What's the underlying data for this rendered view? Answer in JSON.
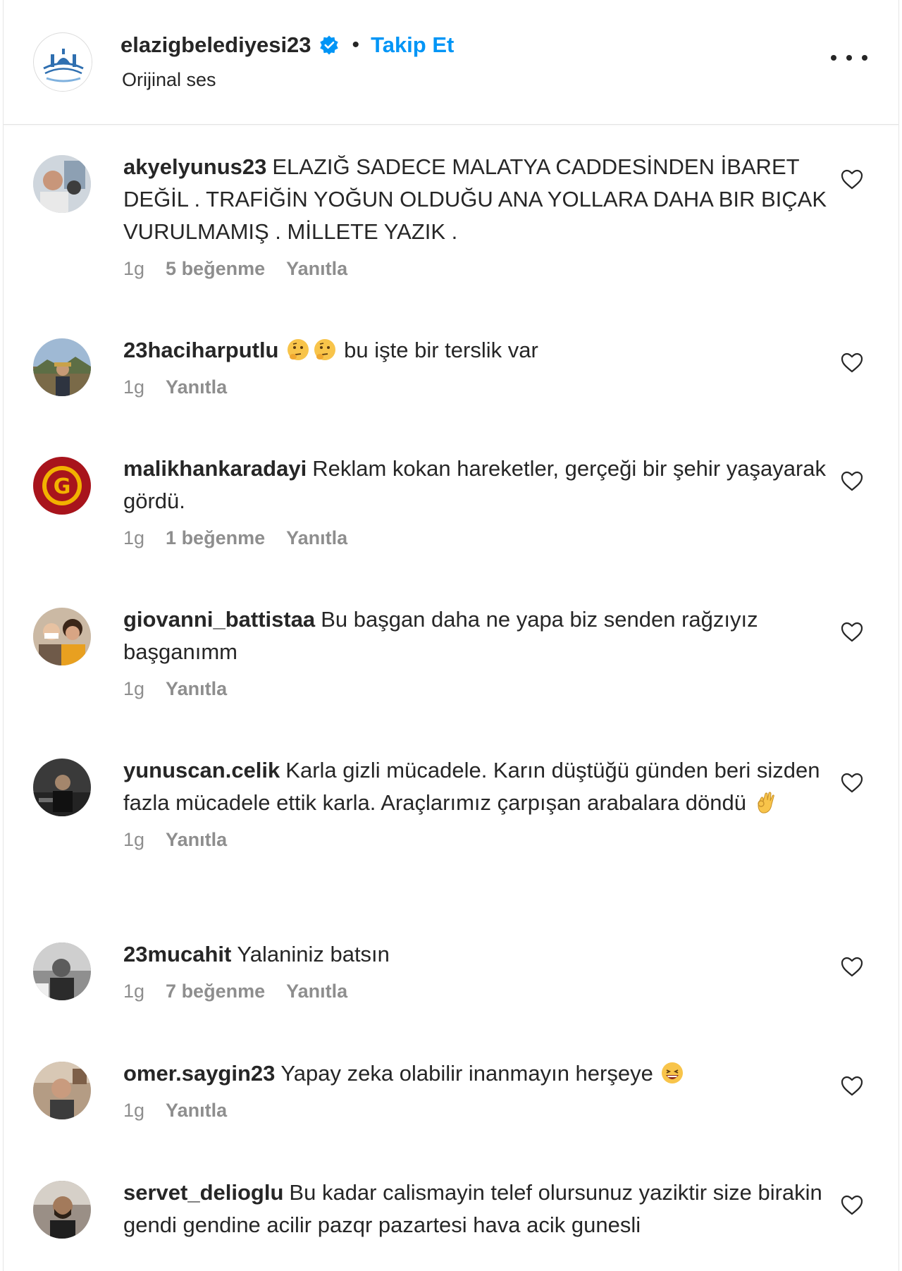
{
  "post": {
    "username": "elazigbelediyesi23",
    "separator": "•",
    "follow_label": "Takip Et",
    "audio_label": "Orijinal ses"
  },
  "icons": {
    "verified": "verified-badge-icon",
    "more": "more-options-icon",
    "like": "heart-icon"
  },
  "colors": {
    "accent": "#0095f6",
    "text": "#262626",
    "secondary": "#8e8e8e"
  },
  "comments": [
    {
      "username": "akyelyunus23",
      "text": "ELAZIĞ SADECE MALATYA CADDESİNDEN İBARET DEĞİL . TRAFİĞİN YOĞUN OLDUĞU ANA YOLLARA DAHA BIR BIÇAK VURULMAMIŞ . MİLLETE YAZIK .",
      "time": "1g",
      "likes": "5 beğenme",
      "reply": "Yanıtla"
    },
    {
      "username": "23haciharputlu",
      "text": "bu işte bir terslik var",
      "emoji": [
        "thinking-face-emoji",
        "thinking-face-emoji"
      ],
      "time": "1g",
      "reply": "Yanıtla"
    },
    {
      "username": "malikhankaradayi",
      "text": "Reklam kokan hareketler, gerçeği bir şehir yaşayarak gördü.",
      "time": "1g",
      "likes": "1 beğenme",
      "reply": "Yanıtla"
    },
    {
      "username": "giovanni_battistaa",
      "text": "Bu başgan daha ne yapa biz senden rağzıyız başganımm",
      "time": "1g",
      "reply": "Yanıtla"
    },
    {
      "username": "yunuscan.celik",
      "text": "Karla gizli mücadele. Karın düştüğü günden beri sizden fazla mücadele ettik karla. Araçlarımız çarpışan arabalara döndü",
      "emoji": [
        "ok-hand-emoji"
      ],
      "time": "1g",
      "reply": "Yanıtla"
    },
    {
      "username": "23mucahit",
      "text": "Yalaniniz batsın",
      "time": "1g",
      "likes": "7 beğenme",
      "reply": "Yanıtla"
    },
    {
      "username": "omer.saygin23",
      "text": "Yapay zeka olabilir inanmayın herşeye",
      "emoji": [
        "laughing-face-emoji"
      ],
      "time": "1g",
      "reply": "Yanıtla"
    },
    {
      "username": "servet_delioglu",
      "text": "Bu kadar calismayin telef olursunuz yaziktir size birakin gendi gendine acilir pazqr pazartesi hava acik gunesli"
    }
  ]
}
